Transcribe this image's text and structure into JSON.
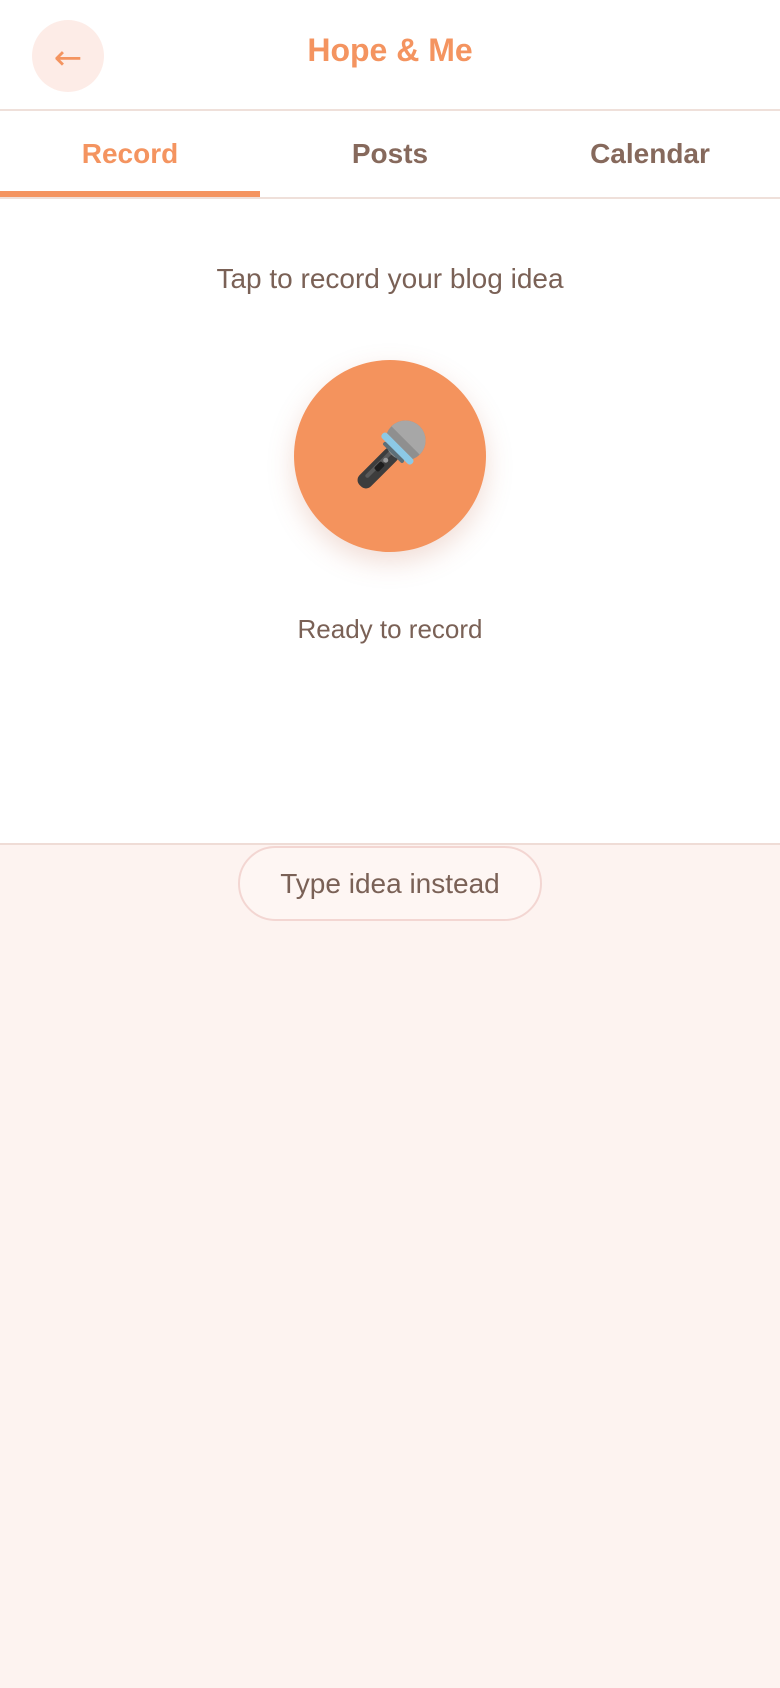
{
  "header": {
    "back_icon": "←",
    "title": "Hope & Me"
  },
  "tabs": [
    {
      "label": "Record",
      "active": true
    },
    {
      "label": "Posts",
      "active": false
    },
    {
      "label": "Calendar",
      "active": false
    }
  ],
  "record": {
    "prompt": "Tap to record your blog idea",
    "mic_icon": "microphone-icon",
    "status": "Ready to record",
    "type_instead_label": "Type idea instead"
  },
  "colors": {
    "accent": "#f49460",
    "text": "#7a6156",
    "background": "#fdf3f0"
  }
}
